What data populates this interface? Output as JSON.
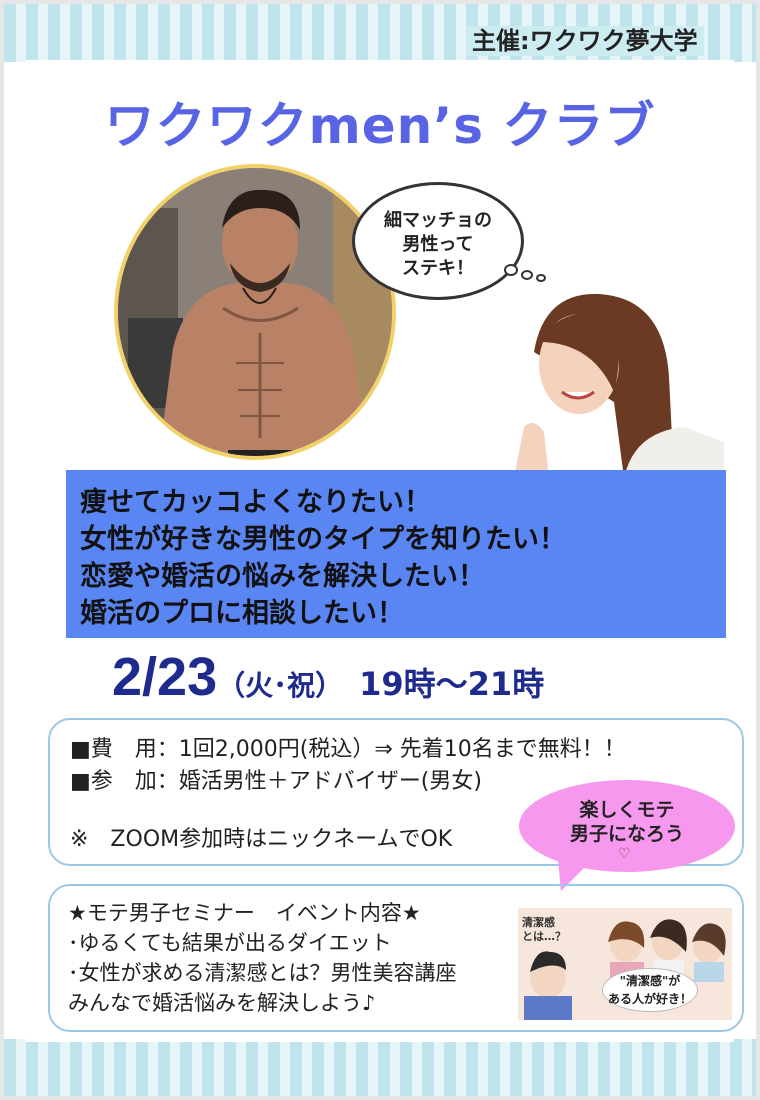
{
  "organizer": "主催:ワクワク夢大学",
  "title": "ワクワクmen’s クラブ",
  "thought_bubble": [
    "細マッチョの",
    "男性って",
    "ステキ！"
  ],
  "goals": [
    "痩せてカッコよくなりたい！",
    "女性が好きな男性のタイプを知りたい！",
    "恋愛や婚活の悩みを解決したい！",
    "婚活のプロに相談したい！"
  ],
  "date": {
    "day": "2/23",
    "weekday": "（火･祝）",
    "time": "19時～21時"
  },
  "info": {
    "fee": "■費　用：1回2,000円(税込）⇒ 先着10名まで無料！！",
    "participants": "■参　加：婚活男性＋アドバイザー(男女)",
    "note": "※　ZOOM参加時はニックネームでOK"
  },
  "pink_bubble": [
    "楽しくモテ",
    "男子になろう"
  ],
  "pink_heart": "♡",
  "seminar": [
    "★モテ男子セミナー　イベント内容★",
    "･ゆるくても結果が出るダイエット",
    "･女性が求める清潔感とは？男性美容講座",
    "みんなで婚活悩みを解決しよう♪"
  ],
  "illustration_text": {
    "question": [
      "清潔感",
      "とは…？"
    ],
    "oval": [
      "\"清潔感\"が",
      "ある人が好き！"
    ]
  },
  "colors": {
    "title": "#5864e4",
    "goals_box": "#5a86f4",
    "date": "#1e2b8c",
    "pink": "#f598ee",
    "frame": "#9cc8e6"
  }
}
